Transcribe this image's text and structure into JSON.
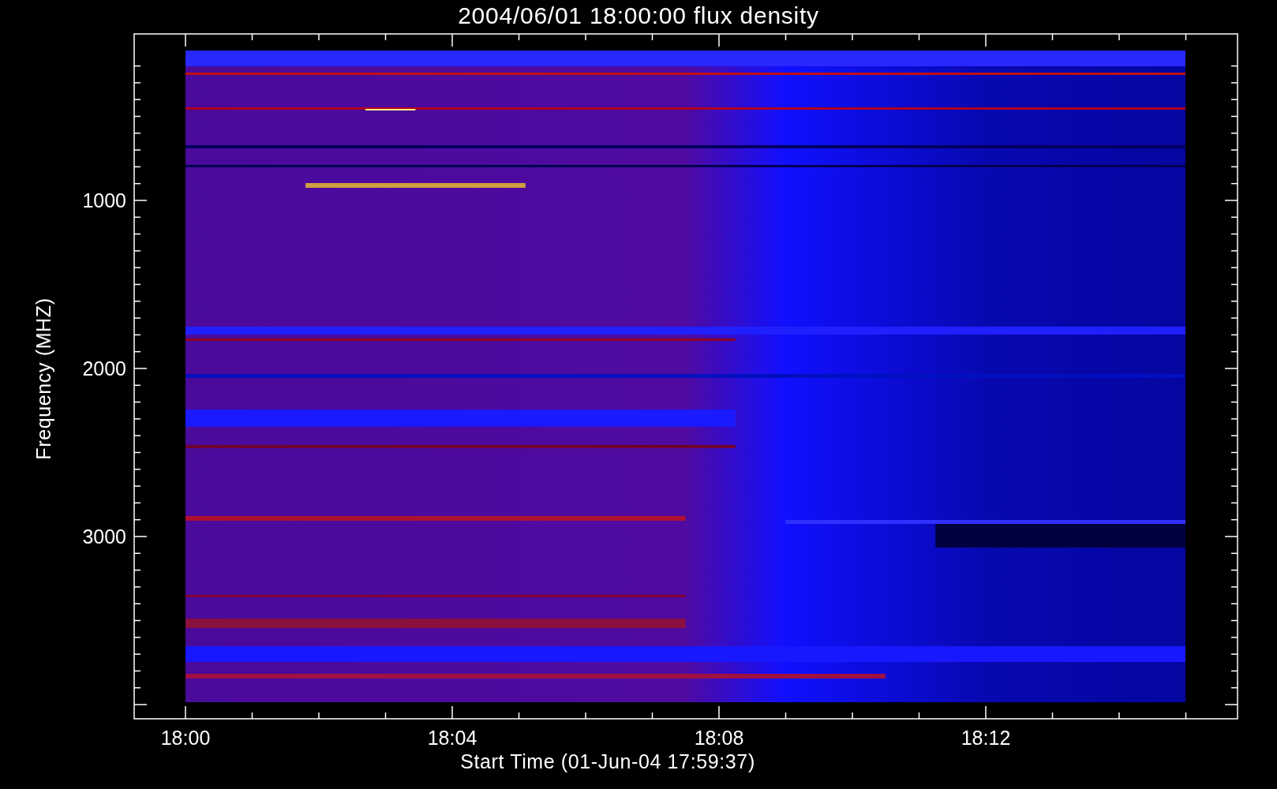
{
  "title": "2004/06/01 18:00:00 flux density",
  "ylabel": "Frequency (MHZ)",
  "xlabel": "Start Time (01-Jun-04 17:59:37)",
  "yticks": [
    "1000",
    "2000",
    "3000"
  ],
  "xticks": [
    "18:00",
    "18:04",
    "18:08",
    "18:12"
  ]
}
